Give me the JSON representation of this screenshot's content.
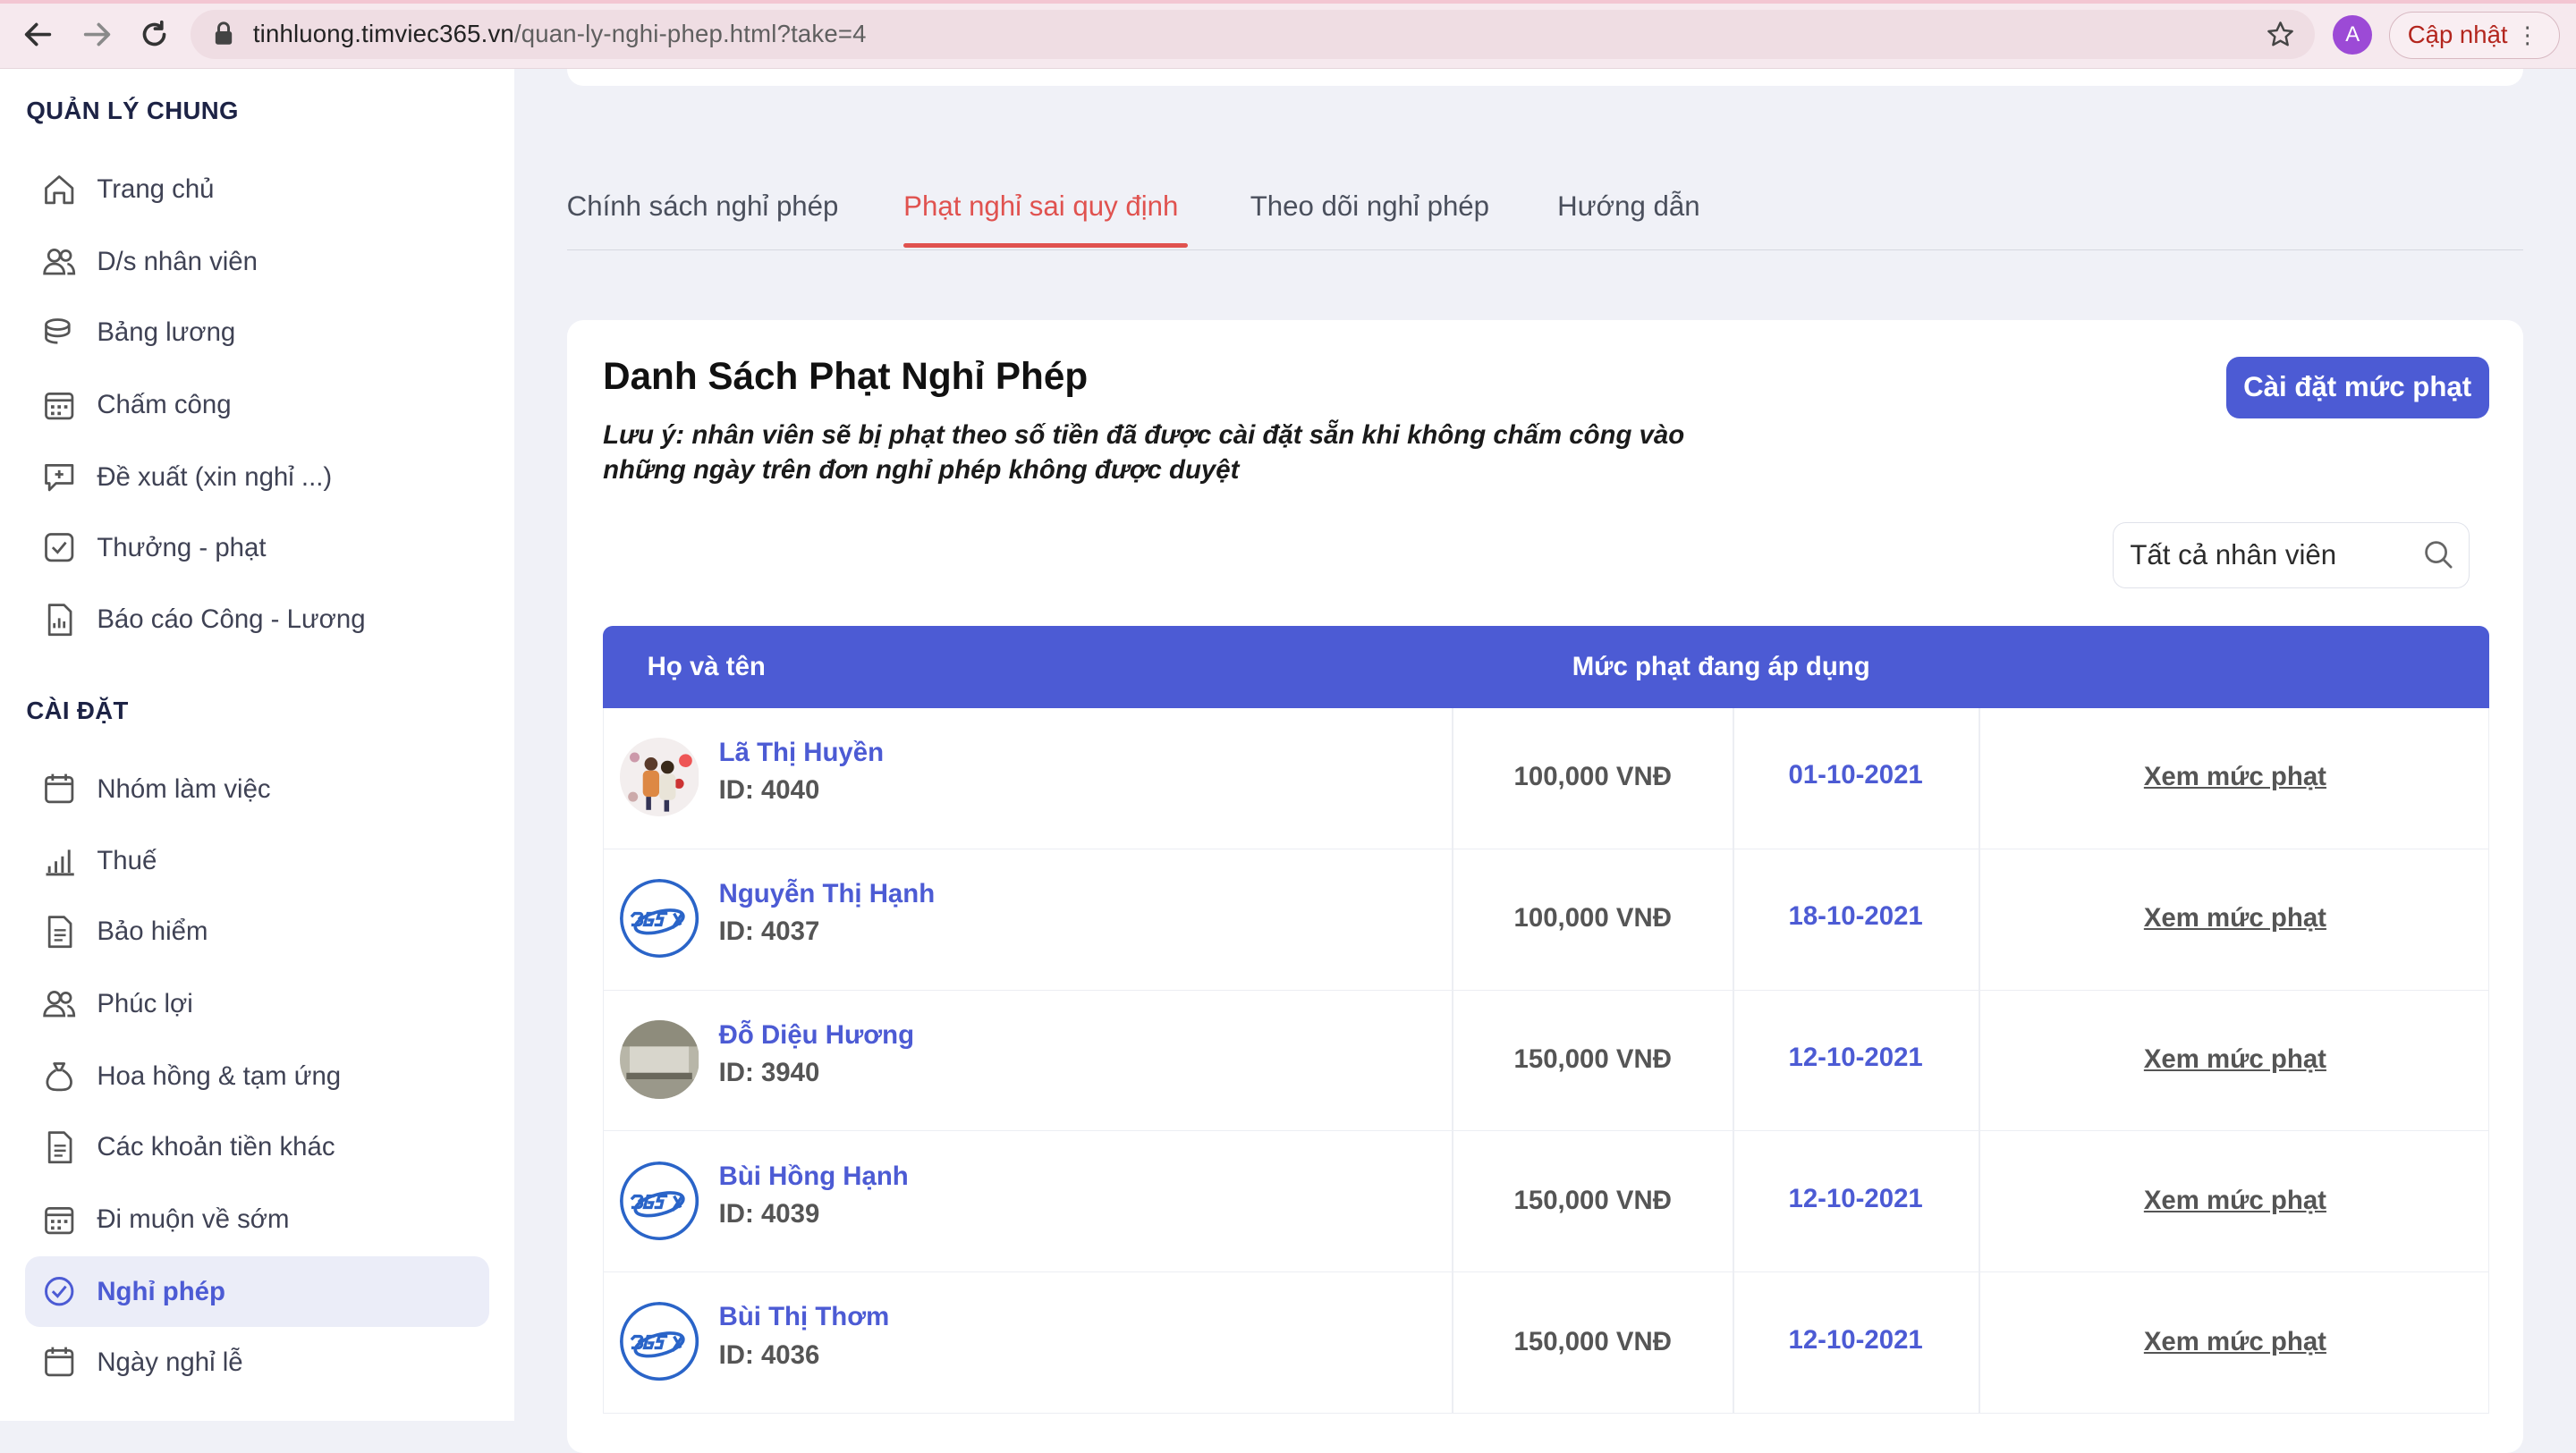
{
  "browser": {
    "url_host": "tinhluong.timviec365.vn",
    "url_path": "/quan-ly-nghi-phep.html?take=4",
    "profile_initial": "A",
    "update_label": "Cập nhật",
    "menu_glyph": "⋮"
  },
  "sidebar": {
    "section_general": "QUẢN LÝ CHUNG",
    "general_items": [
      {
        "label": "Trang chủ",
        "icon": "home-icon"
      },
      {
        "label": "D/s nhân viên",
        "icon": "users-icon"
      },
      {
        "label": "Bảng lương",
        "icon": "coins-icon"
      },
      {
        "label": "Chấm công",
        "icon": "calendar-grid-icon"
      },
      {
        "label": "Đề xuất (xin nghỉ ...)",
        "icon": "comment-plus-icon"
      },
      {
        "label": "Thưởng - phạt",
        "icon": "check-square-icon"
      },
      {
        "label": "Báo cáo Công - Lương",
        "icon": "report-icon"
      }
    ],
    "section_settings": "CÀI ĐẶT",
    "settings_items": [
      {
        "label": "Nhóm làm việc",
        "icon": "calendar-icon"
      },
      {
        "label": "Thuế",
        "icon": "bar-chart-icon"
      },
      {
        "label": "Bảo hiểm",
        "icon": "document-icon"
      },
      {
        "label": "Phúc lợi",
        "icon": "users-icon"
      },
      {
        "label": "Hoa hồng & tạm ứng",
        "icon": "money-bag-icon"
      },
      {
        "label": "Các khoản tiền khác",
        "icon": "document-icon"
      },
      {
        "label": "Đi muộn về sớm",
        "icon": "calendar-grid-icon"
      },
      {
        "label": "Nghỉ phép",
        "icon": "check-circle-icon",
        "active": true
      },
      {
        "label": "Ngày nghỉ lễ",
        "icon": "calendar-icon"
      }
    ]
  },
  "tabs": [
    "Chính sách nghỉ phép",
    "Phạt nghỉ sai quy định",
    "Theo dõi nghỉ phép",
    "Hướng dẫn"
  ],
  "active_tab": "Phạt nghỉ sai quy định",
  "panel": {
    "title": "Danh Sách Phạt Nghỉ Phép",
    "note": "Lưu ý: nhân viên sẽ bị phạt theo số tiền đã được cài đặt sẵn khi không chấm công vào những ngày trên đơn nghỉ phép không được duyệt",
    "settings_button": "Cài đặt mức phạt",
    "filter_value": "Tất cả nhân viên"
  },
  "table": {
    "col_name": "Họ và tên",
    "col_penalty": "Mức phạt đang áp dụng",
    "rows": [
      {
        "name": "Lã Thị Huyền",
        "id": "ID: 4040",
        "amount": "100,000 VNĐ",
        "date": "01-10-2021",
        "action": "Xem mức phạt",
        "avatar": "photo"
      },
      {
        "name": "Nguyễn Thị Hạnh",
        "id": "ID: 4037",
        "amount": "100,000 VNĐ",
        "date": "18-10-2021",
        "action": "Xem mức phạt",
        "avatar": "365"
      },
      {
        "name": "Đỗ Diệu Hương",
        "id": "ID: 3940",
        "amount": "150,000 VNĐ",
        "date": "12-10-2021",
        "action": "Xem mức phạt",
        "avatar": "photo2"
      },
      {
        "name": "Bùi Hồng Hạnh",
        "id": "ID: 4039",
        "amount": "150,000 VNĐ",
        "date": "12-10-2021",
        "action": "Xem mức phạt",
        "avatar": "365"
      },
      {
        "name": "Bùi Thị Thơm",
        "id": "ID: 4036",
        "amount": "150,000 VNĐ",
        "date": "12-10-2021",
        "action": "Xem mức phạt",
        "avatar": "365"
      }
    ]
  },
  "colors": {
    "accent": "#4c5bd4",
    "active_tab": "#e0524f",
    "page_bg": "#f0f1f7"
  }
}
